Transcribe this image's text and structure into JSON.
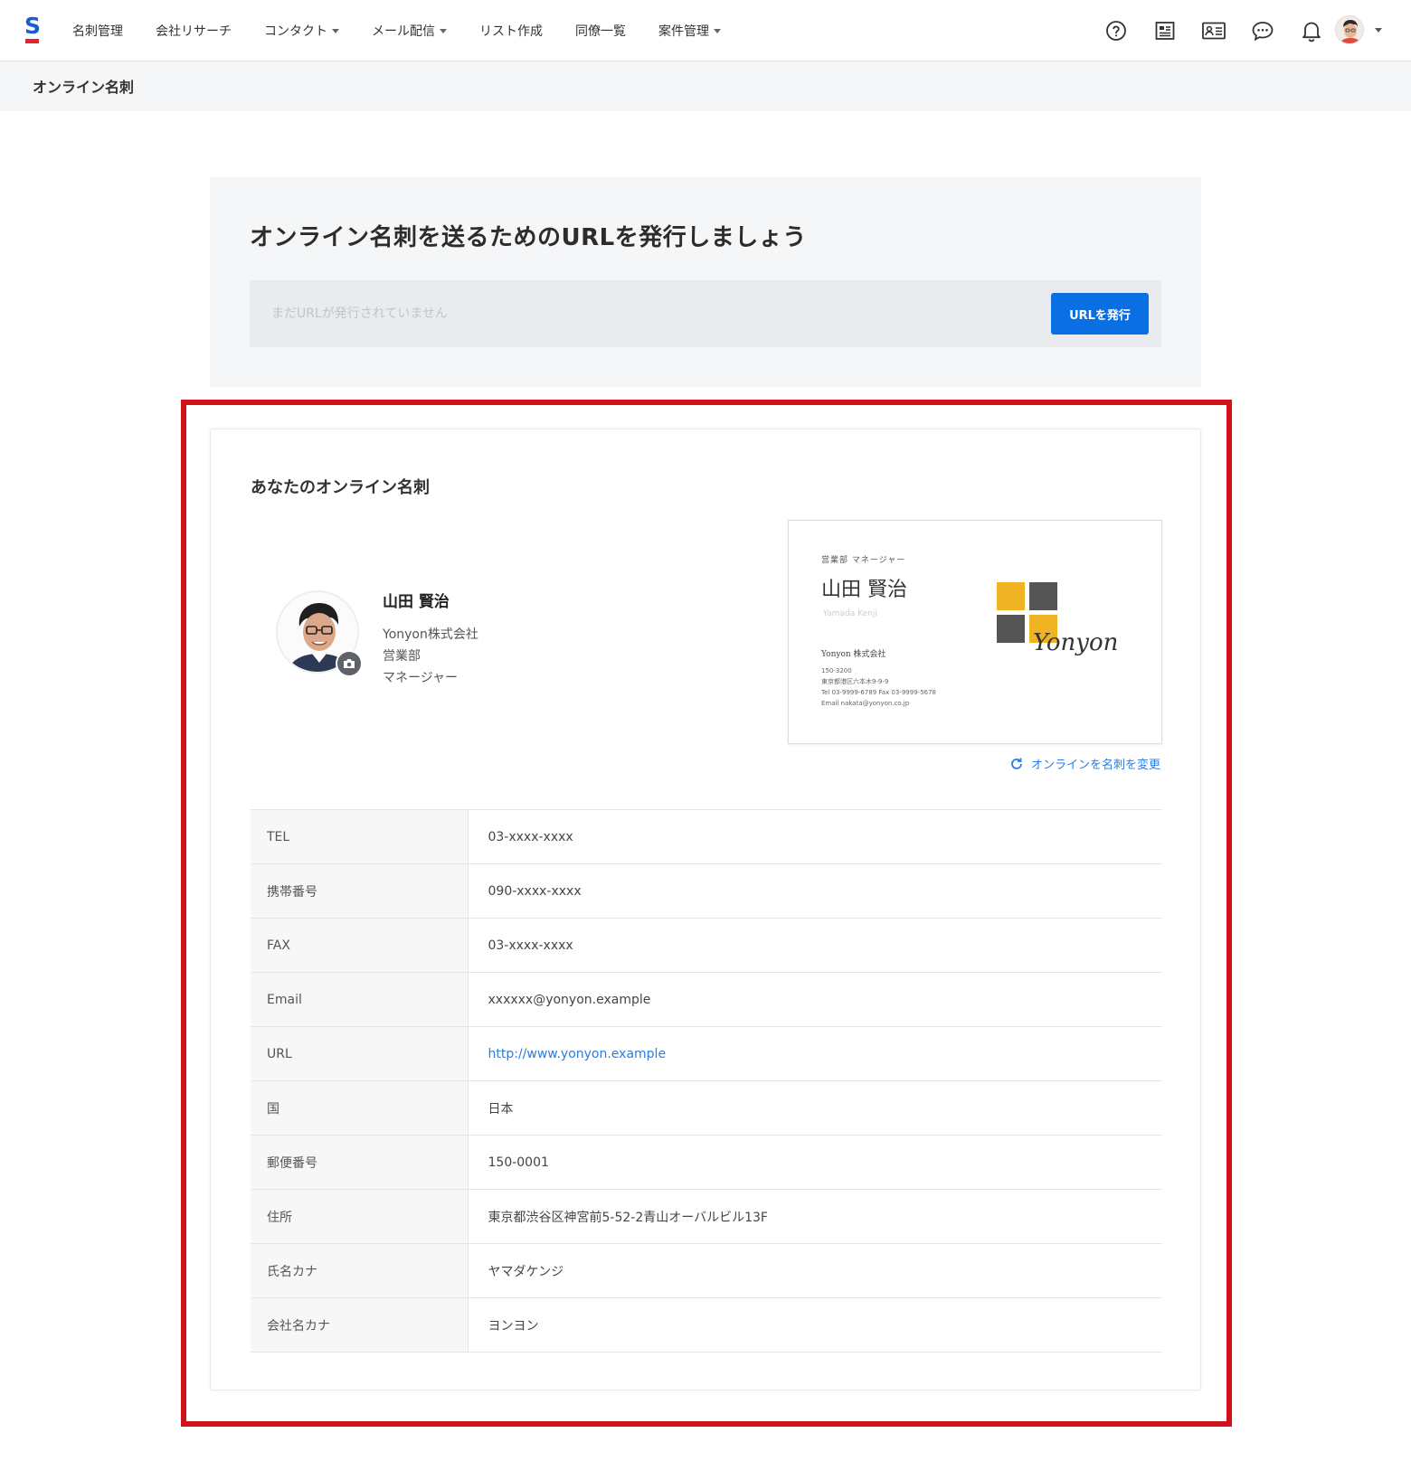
{
  "nav": {
    "logo": "S",
    "items": [
      {
        "label": "名刺管理",
        "dropdown": false
      },
      {
        "label": "会社リサーチ",
        "dropdown": false
      },
      {
        "label": "コンタクト",
        "dropdown": true
      },
      {
        "label": "メール配信",
        "dropdown": true
      },
      {
        "label": "リスト作成",
        "dropdown": false
      },
      {
        "label": "同僚一覧",
        "dropdown": false
      },
      {
        "label": "案件管理",
        "dropdown": true
      }
    ],
    "icons": [
      "help-icon",
      "news-icon",
      "business-card-icon",
      "chat-icon",
      "bell-icon"
    ]
  },
  "page": {
    "title": "オンライン名刺"
  },
  "url_panel": {
    "heading": "オンライン名刺を送るためのURLを発行しましょう",
    "placeholder": "まだURLが発行されていません",
    "button": "URLを発行"
  },
  "card": {
    "heading": "あなたのオンライン名刺",
    "profile": {
      "name": "山田 賢治",
      "company": "Yonyon株式会社",
      "department": "営業部",
      "position": "マネージャー"
    },
    "business_card": {
      "title": "営業部 マネージャー",
      "name": "山田 賢治",
      "roman": "Yamada Kenji",
      "company": "Yonyon 株式会社",
      "zip": "150-3200",
      "address": "東京都港区六本木9-9-9",
      "tel_fax": "Tel 03-9999-6789   Fax 03-9999-5678",
      "email": "Email nakata@yonyon.co.jp",
      "logo_text": "Yonyon"
    },
    "change_link": "オンラインを名刺を変更",
    "rows": [
      {
        "label": "TEL",
        "value": "03-xxxx-xxxx"
      },
      {
        "label": "携帯番号",
        "value": "090-xxxx-xxxx"
      },
      {
        "label": "FAX",
        "value": "03-xxxx-xxxx"
      },
      {
        "label": "Email",
        "value": "xxxxxx@yonyon.example"
      },
      {
        "label": "URL",
        "value": "http://www.yonyon.example"
      },
      {
        "label": "国",
        "value": "日本"
      },
      {
        "label": "郵便番号",
        "value": "150-0001"
      },
      {
        "label": "住所",
        "value": "東京都渋谷区神宮前5-52-2青山オーバルビル13F"
      },
      {
        "label": "氏名カナ",
        "value": "ヤマダケンジ"
      },
      {
        "label": "会社名カナ",
        "value": "ヨンヨン"
      }
    ]
  },
  "colors": {
    "primary": "#0a6fe3",
    "link": "#2a7de1",
    "highlight": "#d0121b",
    "logo_yellow": "#f0b323",
    "logo_gray": "#555555"
  }
}
